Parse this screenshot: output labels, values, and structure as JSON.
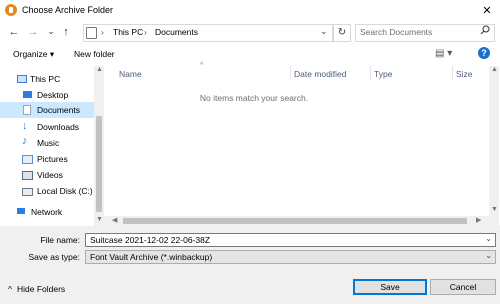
{
  "window": {
    "title": "Choose Archive Folder",
    "close_glyph": "✕"
  },
  "nav": {
    "back": "←",
    "forward": "→",
    "dropdown": "⌄",
    "up": "↑",
    "breadcrumbs": [
      "This PC",
      "Documents"
    ],
    "separator": "›",
    "refresh": "↻",
    "search_placeholder": "Search Documents",
    "search_icon": "search-icon"
  },
  "toolbar": {
    "organize": "Organize ▾",
    "new_folder": "New folder",
    "view_glyph": "▤ ▾",
    "help_glyph": "?"
  },
  "sidebar": {
    "items": [
      {
        "label": "This PC",
        "icon": "computer-icon",
        "color": "#3a7bd5"
      },
      {
        "label": "Desktop",
        "icon": "desktop-icon",
        "color": "#2c7fd9"
      },
      {
        "label": "Documents",
        "icon": "documents-icon",
        "color": "#9aa6b3",
        "selected": true
      },
      {
        "label": "Downloads",
        "icon": "downloads-icon",
        "color": "#2a7fe0"
      },
      {
        "label": "Music",
        "icon": "music-icon",
        "color": "#2a7fe0"
      },
      {
        "label": "Pictures",
        "icon": "pictures-icon",
        "color": "#5a8fd0"
      },
      {
        "label": "Videos",
        "icon": "videos-icon",
        "color": "#5a6b80"
      },
      {
        "label": "Local Disk (C:)",
        "icon": "disk-icon",
        "color": "#6b7a8a"
      },
      {
        "label": "Network",
        "icon": "network-icon",
        "color": "#2a7fe0"
      }
    ]
  },
  "filelist": {
    "columns": [
      "Name",
      "Date modified",
      "Type",
      "Size"
    ],
    "sort_caret": "^",
    "empty_message": "No items match your search."
  },
  "form": {
    "file_name_label": "File name:",
    "file_name_value": "Suitcase 2021-12-02 22-06-38Z",
    "save_type_label": "Save as type:",
    "save_type_value": "Font Vault Archive (*.winbackup)",
    "dropdown_glyph": "⌄"
  },
  "footer": {
    "hide_folders": "Hide Folders",
    "hide_glyph": "^",
    "save": "Save",
    "cancel": "Cancel"
  }
}
